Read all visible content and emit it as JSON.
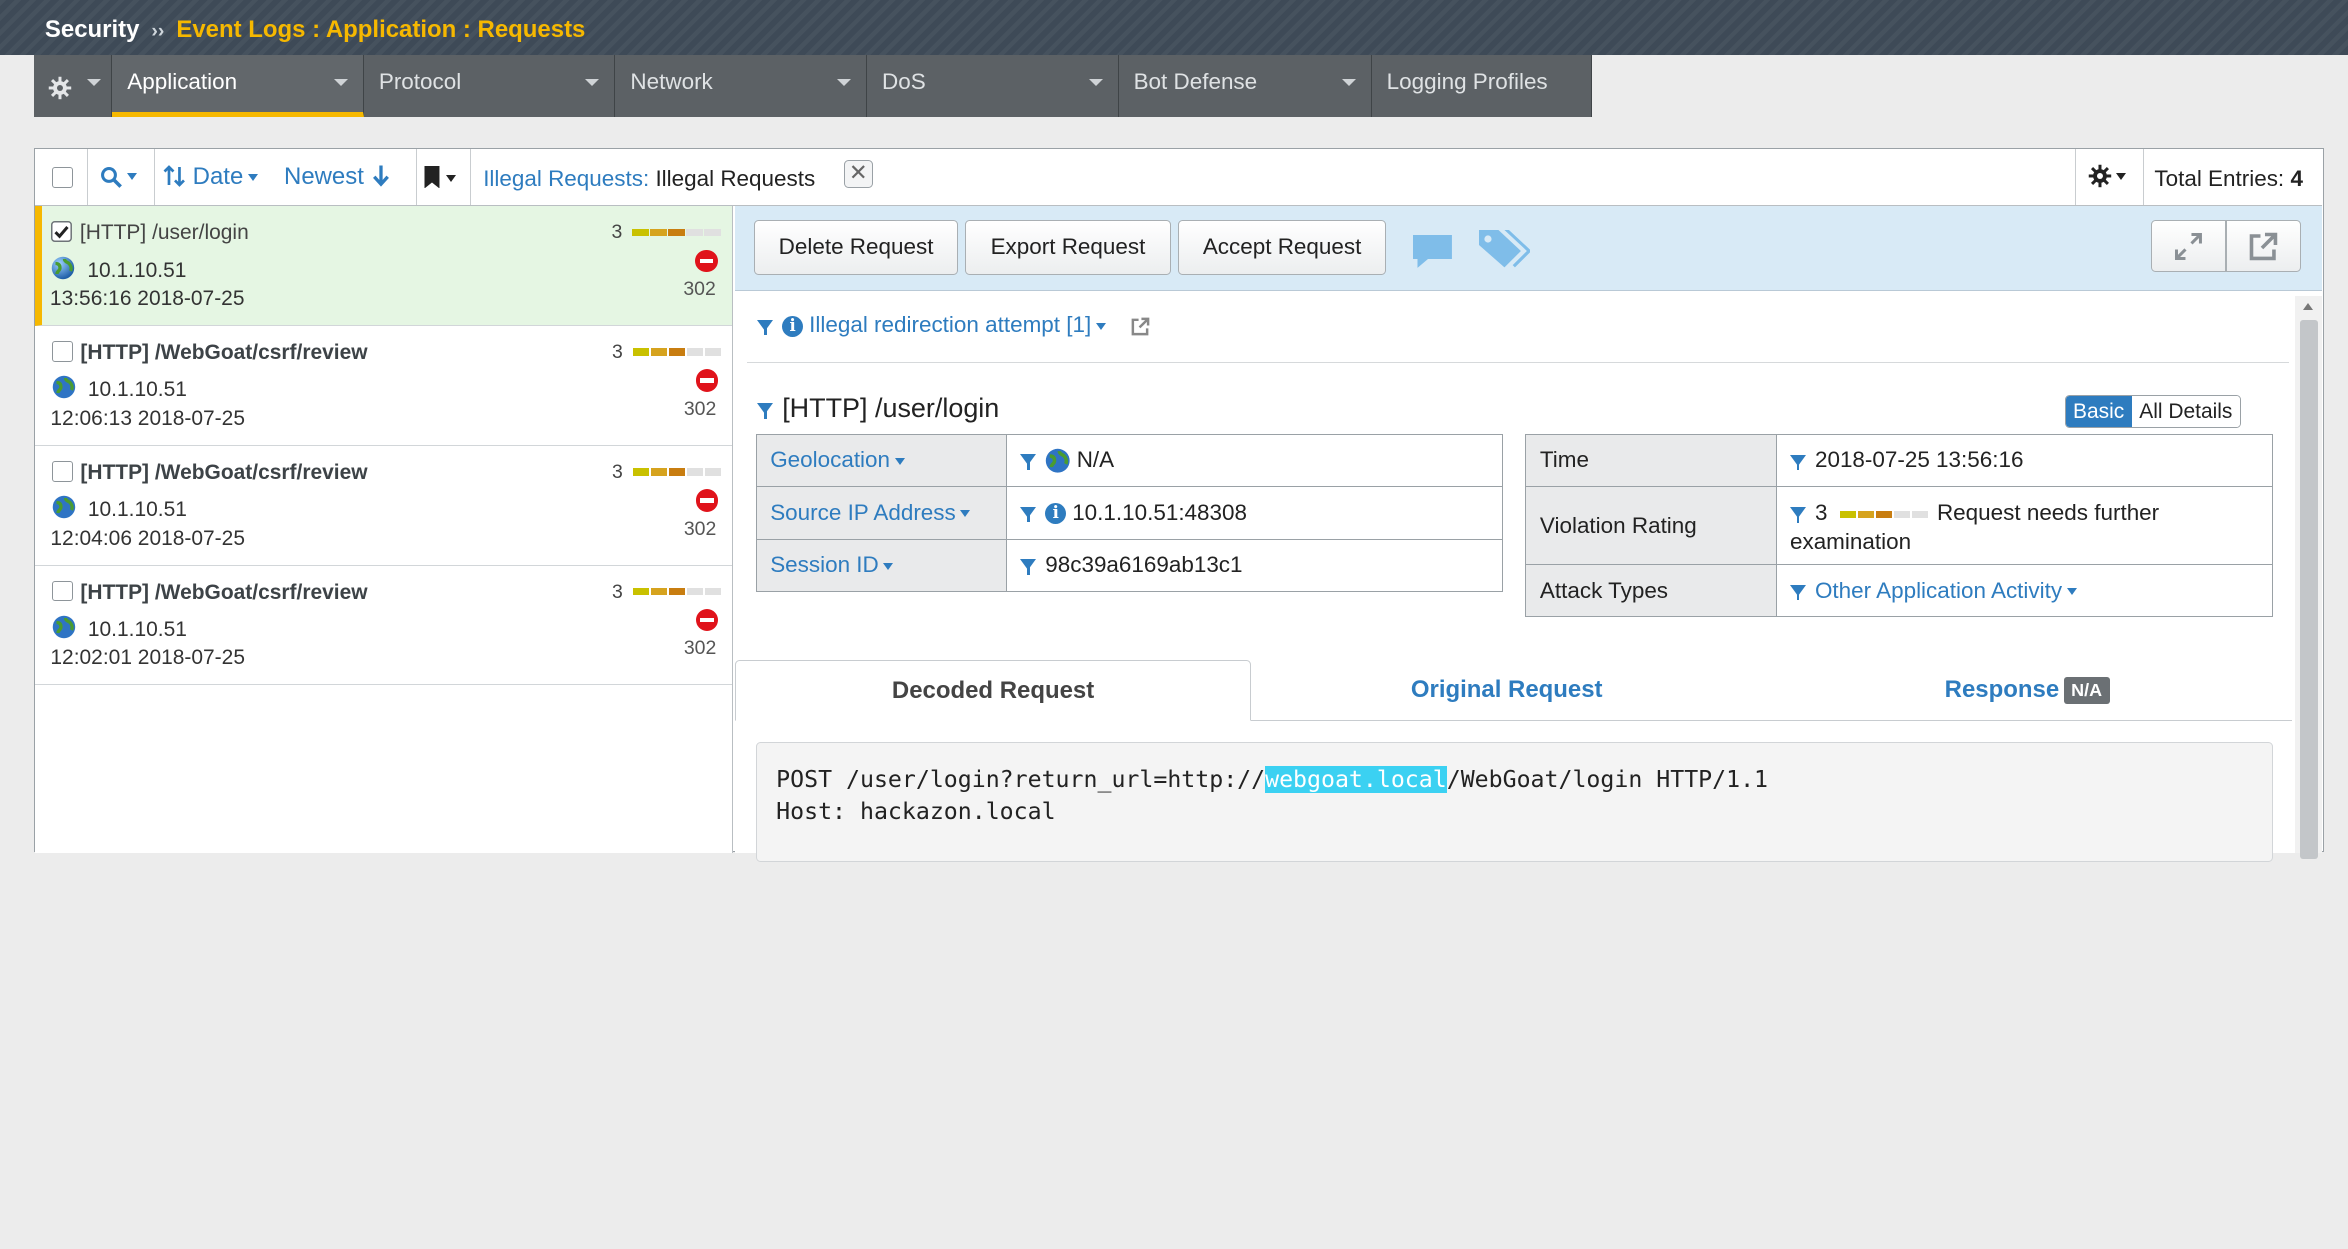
{
  "breadcrumb": {
    "section": "Security",
    "separator": "››",
    "path": "Event Logs : Application : Requests"
  },
  "nav_tabs": [
    {
      "label": "Application",
      "active": true
    },
    {
      "label": "Protocol",
      "active": false
    },
    {
      "label": "Network",
      "active": false
    },
    {
      "label": "DoS",
      "active": false
    },
    {
      "label": "Bot Defense",
      "active": false
    },
    {
      "label": "Logging Profiles",
      "active": false
    }
  ],
  "toolbar": {
    "sort_field": "Date",
    "sort_order": "Newest",
    "filter_label": "Illegal Requests:",
    "filter_value": "Illegal Requests",
    "total_label": "Total Entries:",
    "total_value": "4"
  },
  "requests": [
    {
      "protocol": "[HTTP]",
      "path": "/user/login",
      "ip": "10.1.10.51",
      "timestamp": "13:56:16 2018-07-25",
      "rating": "3",
      "code": "302",
      "selected": true
    },
    {
      "protocol": "[HTTP]",
      "path": "/WebGoat/csrf/review",
      "ip": "10.1.10.51",
      "timestamp": "12:06:13 2018-07-25",
      "rating": "3",
      "code": "302",
      "selected": false
    },
    {
      "protocol": "[HTTP]",
      "path": "/WebGoat/csrf/review",
      "ip": "10.1.10.51",
      "timestamp": "12:04:06 2018-07-25",
      "rating": "3",
      "code": "302",
      "selected": false
    },
    {
      "protocol": "[HTTP]",
      "path": "/WebGoat/csrf/review",
      "ip": "10.1.10.51",
      "timestamp": "12:02:01 2018-07-25",
      "rating": "3",
      "code": "302",
      "selected": false
    }
  ],
  "actions": {
    "delete": "Delete Request",
    "export": "Export Request",
    "accept": "Accept Request"
  },
  "detail": {
    "violation": "Illegal redirection attempt [1]",
    "title": "[HTTP] /user/login",
    "view_basic": "Basic",
    "view_all": "All Details",
    "left_fields": [
      {
        "label": "Geolocation",
        "value": "N/A"
      },
      {
        "label": "Source IP Address",
        "value": "10.1.10.51:48308"
      },
      {
        "label": "Session ID",
        "value": "98c39a6169ab13c1"
      }
    ],
    "right_fields": {
      "time_label": "Time",
      "time_value": "2018-07-25 13:56:16",
      "rating_label": "Violation Rating",
      "rating_value": "3",
      "rating_text": "Request needs further examination",
      "attack_label": "Attack Types",
      "attack_value": "Other Application Activity"
    },
    "subtabs": {
      "decoded": "Decoded Request",
      "original": "Original Request",
      "response": "Response",
      "response_badge": "N/A"
    },
    "request_lines": {
      "line1_pre": "POST /user/login?return_url=http://",
      "line1_hl": "webgoat.local",
      "line1_post": "/WebGoat/login HTTP/1.1",
      "line2": "Host: hackazon.local"
    }
  },
  "colors": {
    "accent": "#f6b800",
    "link": "#2e7cbf",
    "selected_row": "#e5f6e3",
    "action_bar": "#d8eaf6",
    "block_red": "#e0131b"
  }
}
